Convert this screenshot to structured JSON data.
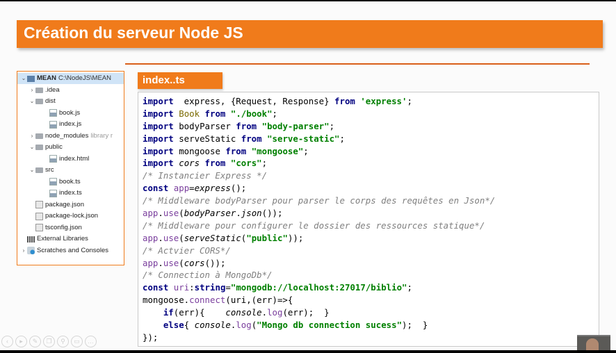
{
  "slide": {
    "title": "Création du serveur Node JS"
  },
  "tree": {
    "project_name": "MEAN",
    "project_path": "C:\\NodeJS\\MEAN",
    "items": [
      {
        "label": "MEAN",
        "extra": "C:\\NodeJS\\MEAN",
        "type": "project",
        "arrow": "⌄",
        "depth": 0,
        "selected": true
      },
      {
        "label": ".idea",
        "type": "folder",
        "arrow": "›",
        "depth": 1
      },
      {
        "label": "dist",
        "type": "folder",
        "arrow": "⌄",
        "depth": 1
      },
      {
        "label": "book.js",
        "type": "js",
        "arrow": "",
        "depth": 2
      },
      {
        "label": "index.js",
        "type": "js",
        "arrow": "",
        "depth": 2
      },
      {
        "label": "node_modules",
        "extra": "library r",
        "type": "folder",
        "arrow": "›",
        "depth": 1
      },
      {
        "label": "public",
        "type": "folder",
        "arrow": "⌄",
        "depth": 1
      },
      {
        "label": "index.html",
        "type": "js",
        "arrow": "",
        "depth": 2
      },
      {
        "label": "src",
        "type": "folder",
        "arrow": "⌄",
        "depth": 1
      },
      {
        "label": "book.ts",
        "type": "js",
        "arrow": "",
        "depth": 2
      },
      {
        "label": "index.ts",
        "type": "js",
        "arrow": "",
        "depth": 2
      },
      {
        "label": "package.json",
        "type": "json",
        "arrow": "",
        "depth": 1
      },
      {
        "label": "package-lock.json",
        "type": "json",
        "arrow": "",
        "depth": 1
      },
      {
        "label": "tsconfig.json",
        "type": "json",
        "arrow": "",
        "depth": 1
      },
      {
        "label": "External Libraries",
        "type": "lib",
        "arrow": "",
        "depth": 0
      },
      {
        "label": "Scratches and Consoles",
        "type": "scratch",
        "arrow": "›",
        "depth": 0
      }
    ]
  },
  "editor": {
    "filename": "index..ts",
    "lines": [
      [
        [
          "kw",
          "import"
        ],
        [
          "",
          "  express, {Request, Response} "
        ],
        [
          "kw",
          "from"
        ],
        [
          "",
          " "
        ],
        [
          "str",
          "'express'"
        ],
        [
          "",
          ";"
        ]
      ],
      [
        [
          "kw",
          "import"
        ],
        [
          "",
          " "
        ],
        [
          "cls",
          "Book"
        ],
        [
          "",
          " "
        ],
        [
          "kw",
          "from"
        ],
        [
          "",
          " "
        ],
        [
          "str",
          "\"./book\""
        ],
        [
          "",
          ";"
        ]
      ],
      [
        [
          "kw",
          "import"
        ],
        [
          "",
          " bodyParser "
        ],
        [
          "kw",
          "from"
        ],
        [
          "",
          " "
        ],
        [
          "str",
          "\"body-parser\""
        ],
        [
          "",
          ";"
        ]
      ],
      [
        [
          "kw",
          "import"
        ],
        [
          "",
          " serveStatic "
        ],
        [
          "kw",
          "from"
        ],
        [
          "",
          " "
        ],
        [
          "str",
          "\"serve-static\""
        ],
        [
          "",
          ";"
        ]
      ],
      [
        [
          "kw",
          "import"
        ],
        [
          "",
          " mongoose "
        ],
        [
          "kw",
          "from"
        ],
        [
          "",
          " "
        ],
        [
          "str",
          "\"mongoose\""
        ],
        [
          "",
          ";"
        ]
      ],
      [
        [
          "kw",
          "import"
        ],
        [
          "",
          " "
        ],
        [
          "it",
          "cors"
        ],
        [
          "",
          " "
        ],
        [
          "kw",
          "from"
        ],
        [
          "",
          " "
        ],
        [
          "str",
          "\"cors\""
        ],
        [
          "",
          ";"
        ]
      ],
      [
        [
          "cm",
          "/* Instancier Express */"
        ]
      ],
      [
        [
          "kw",
          "const"
        ],
        [
          "",
          " "
        ],
        [
          "fn",
          "app"
        ],
        [
          "",
          "="
        ],
        [
          "it",
          "express"
        ],
        [
          "",
          "();"
        ]
      ],
      [
        [
          "cm",
          "/* Middleware bodyParser pour parser le corps des requêtes en Json*/"
        ]
      ],
      [
        [
          "fn",
          "app"
        ],
        [
          "",
          "."
        ],
        [
          "fn",
          "use"
        ],
        [
          "",
          "("
        ],
        [
          "it",
          "bodyParser"
        ],
        [
          "",
          "."
        ],
        [
          "it",
          "json"
        ],
        [
          "",
          "());"
        ]
      ],
      [
        [
          "cm",
          "/* Middleware pour configurer le dossier des ressources statique*/"
        ]
      ],
      [
        [
          "fn",
          "app"
        ],
        [
          "",
          "."
        ],
        [
          "fn",
          "use"
        ],
        [
          "",
          "("
        ],
        [
          "it",
          "serveStatic"
        ],
        [
          "",
          "("
        ],
        [
          "str",
          "\"public\""
        ],
        [
          "",
          "));"
        ]
      ],
      [
        [
          "cm",
          "/* Actvier CORS*/"
        ]
      ],
      [
        [
          "fn",
          "app"
        ],
        [
          "",
          "."
        ],
        [
          "fn",
          "use"
        ],
        [
          "",
          "("
        ],
        [
          "it",
          "cors"
        ],
        [
          "",
          "());"
        ]
      ],
      [
        [
          "cm",
          "/* Connection à MongoDb*/"
        ]
      ],
      [
        [
          "kw",
          "const"
        ],
        [
          "",
          " "
        ],
        [
          "fn",
          "uri"
        ],
        [
          "",
          ":"
        ],
        [
          "ty",
          "string"
        ],
        [
          "",
          "="
        ],
        [
          "str",
          "\"mongodb://localhost:27017/biblio\""
        ],
        [
          "",
          ";"
        ]
      ],
      [
        [
          "",
          "mongoose."
        ],
        [
          "fn",
          "connect"
        ],
        [
          "",
          "(uri,(err)=>{"
        ]
      ],
      [
        [
          "",
          "    "
        ],
        [
          "kw",
          "if"
        ],
        [
          "",
          "(err){    "
        ],
        [
          "it",
          "console"
        ],
        [
          "",
          "."
        ],
        [
          "fn",
          "log"
        ],
        [
          "",
          "(err);  }"
        ]
      ],
      [
        [
          "",
          "    "
        ],
        [
          "kw",
          "else"
        ],
        [
          "",
          "{ "
        ],
        [
          "it",
          "console"
        ],
        [
          "",
          "."
        ],
        [
          "fn",
          "log"
        ],
        [
          "",
          "("
        ],
        [
          "str",
          "\"Mongo db connection sucess\""
        ],
        [
          "",
          ");  }"
        ]
      ],
      [
        [
          "",
          "});"
        ]
      ]
    ]
  },
  "icons": [
    "back-icon",
    "play-icon",
    "pen-icon",
    "copy-icon",
    "zoom-icon",
    "subtitles-icon",
    "more-icon"
  ],
  "colors": {
    "accent": "#f07b1b",
    "keyword": "#000080",
    "string": "#008000",
    "comment": "#808080"
  }
}
